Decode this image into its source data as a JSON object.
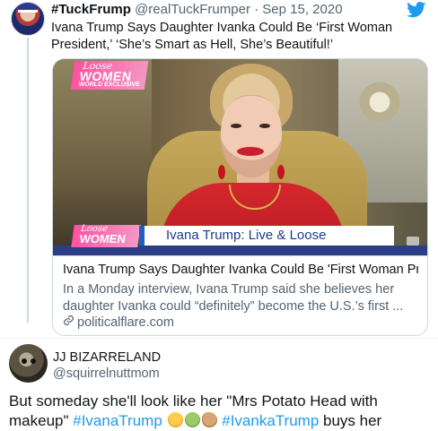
{
  "tweet1": {
    "display_name": "#TuckFrump",
    "handle": "@realTuckFrumper",
    "separator": "·",
    "date": "Sep 15, 2020",
    "text": "Ivana Trump Says Daughter Ivanka Could Be ‘First Woman President,’ ‘She’s Smart as Hell, She’s Beautiful!’",
    "card": {
      "image": {
        "logo_top_script": "Loose",
        "logo_top_word": "WOMEN",
        "logo_top_sub": "WORLD EXCLUSIVE",
        "logo_bottom_script": "Loose",
        "logo_bottom_word": "WOMEN",
        "lower_third": "Ivana Trump: Live & Loose"
      },
      "title": "Ivana Trump Says Daughter Ivanka Could Be 'First Woman Pr...",
      "description": "In a Monday interview, Ivana Trump said she believes her daughter Ivanka could “definitely” become the U.S.’s first ...",
      "domain": "politicalflare.com"
    }
  },
  "tweet2": {
    "display_name": "JJ BIZARRELAND",
    "handle": "@squirrelnuttmom",
    "text_part1": "But someday she'll look like her \"Mrs Potato Head with makeup\" ",
    "hashtag1": "#IvanaTrump",
    "hashtag2": "#IvankaTrump",
    "text_part2": " buys her"
  },
  "icons": {
    "brand": "twitter-bird-icon",
    "link": "link-icon",
    "emojis": [
      "rolling-on-floor-laughing-emoji",
      "nauseated-face-emoji",
      "potato-emoji"
    ]
  },
  "colors": {
    "accent": "#1d9bf0",
    "secondary_text": "#536471",
    "border": "#cfd9de"
  }
}
